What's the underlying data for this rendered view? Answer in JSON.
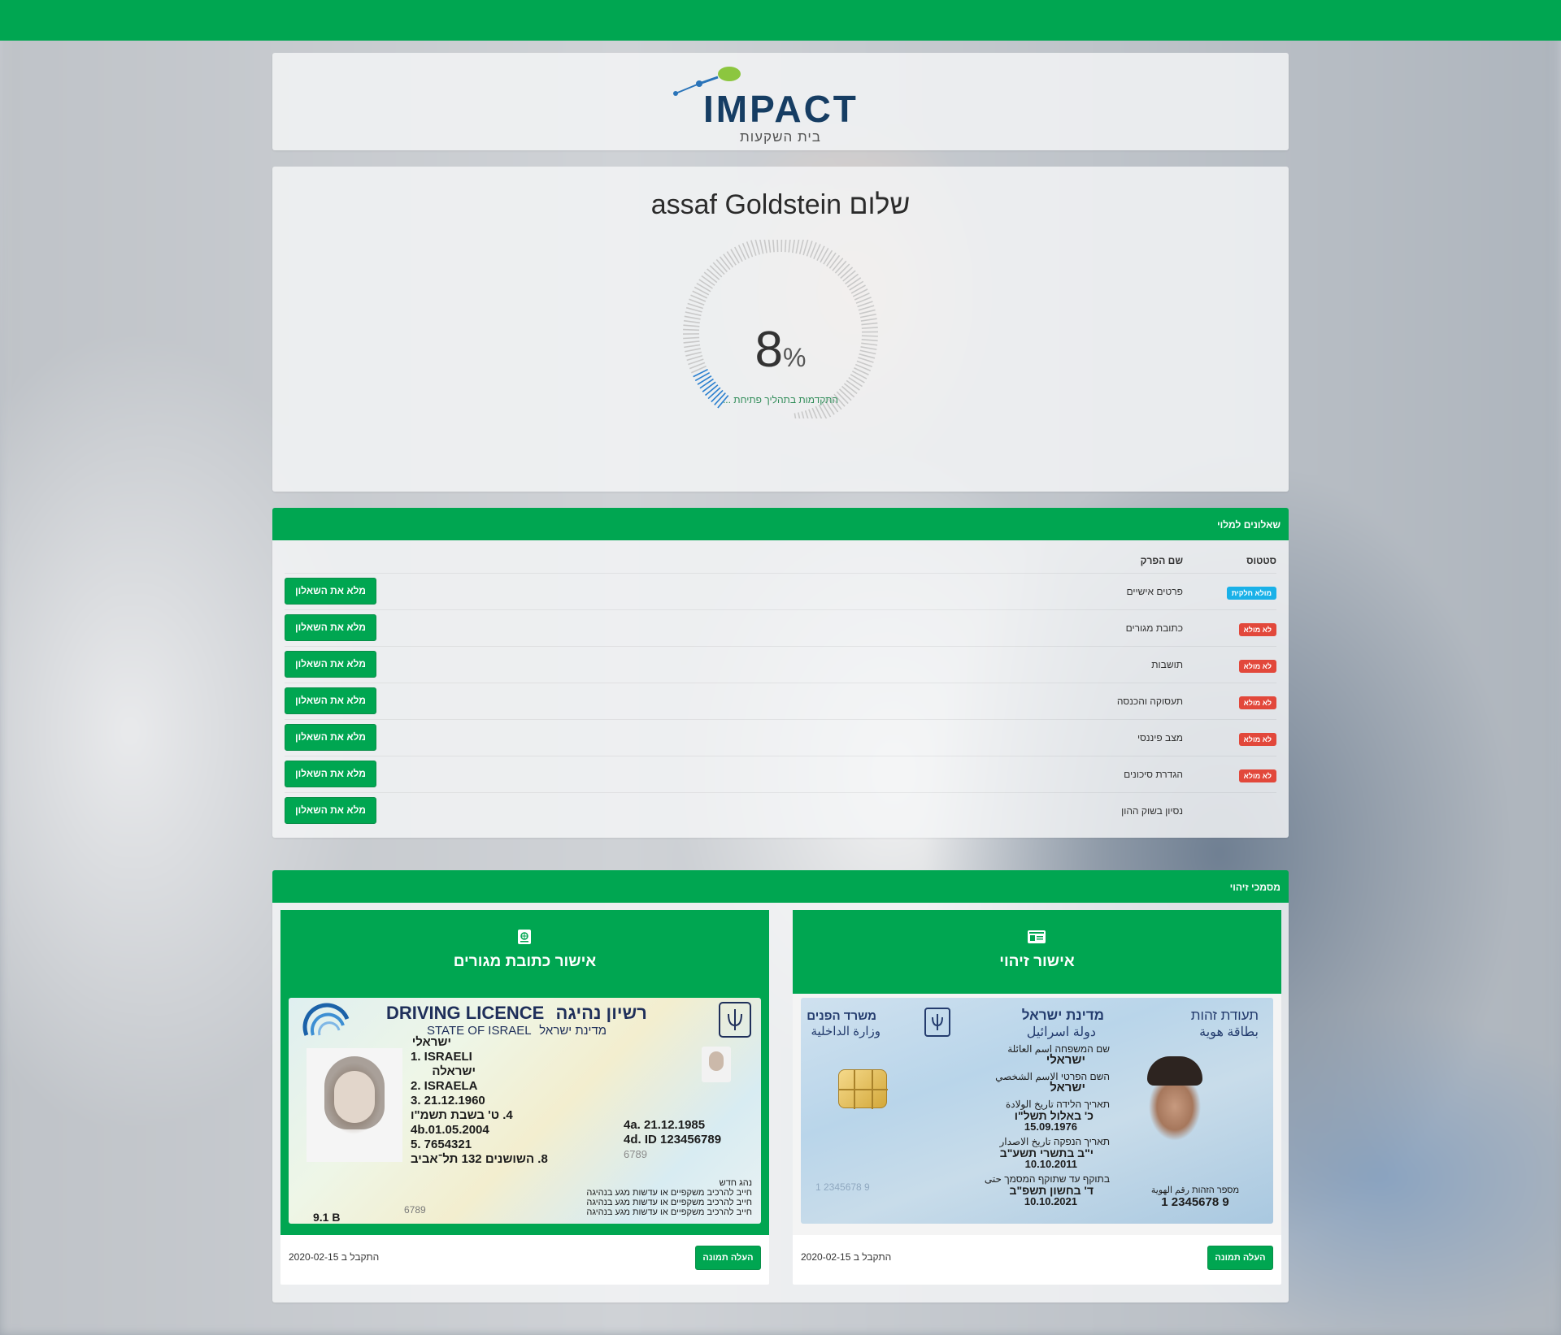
{
  "brand": {
    "logo_text": "IMPACT",
    "logo_subtitle": "בית השקעות",
    "color_primary": "#00a651"
  },
  "greeting": {
    "text": "שלום assaf Goldstein"
  },
  "progress": {
    "value": "8",
    "unit": "%",
    "percent": 8,
    "label": "התקדמות בתהליך פתיחת ..."
  },
  "questionnaires": {
    "title": "שאלונים למלוי",
    "col_status": "סטטוס",
    "col_name": "שם הפרק",
    "rows": [
      {
        "status": "מולא חלקית",
        "status_color": "blue",
        "name": "פרטים אישיים",
        "action": "מלא את השאלון"
      },
      {
        "status": "לא מולא",
        "status_color": "red",
        "name": "כתובת מגורים",
        "action": "מלא את השאלון"
      },
      {
        "status": "לא מולא",
        "status_color": "red",
        "name": "תושבות",
        "action": "מלא את השאלון"
      },
      {
        "status": "לא מולא",
        "status_color": "red",
        "name": "תעסוקה והכנסה",
        "action": "מלא את השאלון"
      },
      {
        "status": "לא מולא",
        "status_color": "red",
        "name": "מצב פיננסי",
        "action": "מלא את השאלון"
      },
      {
        "status": "לא מולא",
        "status_color": "red",
        "name": "הגדרת סיכונים",
        "action": "מלא את השאלון"
      },
      {
        "status": "",
        "status_color": "",
        "name": "נסיון בשוק ההון",
        "action": "מלא את השאלון"
      }
    ]
  },
  "documents": {
    "title": "מסמכי זיהוי",
    "cards": [
      {
        "title": "אישור כתובת מגורים",
        "icon": "address-book-icon",
        "received": "התקבל ב 2020-02-15",
        "upload": "העלה תמונה",
        "card": {
          "title_en": "DRIVING LICENCE",
          "title_he": "רשיון נהיגה",
          "state_en": "STATE OF ISRAEL",
          "state_he": "מדינת ישראל",
          "l1": "ישראלי",
          "f1": "1. ISRAELI",
          "l2": "ישראלה",
          "f2": "2. ISRAELA",
          "f3": "3. 21.12.1960",
          "f4": "4. ט' בשבת תשמ\"ו",
          "f4a": "4a. 21.12.1985",
          "f4b": "4b.01.05.2004",
          "f4d": "4d. ID 123456789",
          "f5": "5. 7654321",
          "f5b": "6789",
          "f8": "8. השושנים 132 תל־אביב",
          "n1": "נהג חדש",
          "n2": "חייב להרכיב משקפיים או עדשות מגע בנהיגה",
          "n3": "חייב להרכיב משקפיים או עדשות מגע בנהיגה",
          "n4": "חייב להרכיב משקפיים או עדשות מגע בנהיגה",
          "code": "6789",
          "cls": "9.1 B"
        }
      },
      {
        "title": "אישור זיהוי",
        "icon": "id-card-icon",
        "received": "התקבל ב 2020-02-15",
        "upload": "העלה תמונה",
        "card": {
          "t1": "תעודת זהות",
          "t1b": "بطاقة هوية",
          "t2": "מדינת ישראל",
          "t2b": "دولة اسرائيل",
          "t3": "משרד הפנים",
          "t3b": "وزارة الداخلية",
          "f_family_label": "שם המשפחה اسم العائلة",
          "f_family": "ישראלי",
          "f_given_label": "השם הפרטי الاسم الشخصي",
          "f_given": "ישראל",
          "f_dob_label": "תאריך הלידה تاريخ الولادة",
          "f_dob": "כ' באלול תשל\"ו",
          "f_dob2": "15.09.1976",
          "f_issue_label": "תאריך הנפקה تاريخ الاصدار",
          "f_issue": "י\"ב בתשרי תשע\"ב",
          "f_issue2": "10.10.2011",
          "f_exp_label": "בתוקף עד שתוקף המסמך حتى",
          "f_exp": "ד' בחשון תשפ\"ב",
          "f_exp2": "10.10.2021",
          "id_label": "מספר הזהות رقم الهوية",
          "id_num": "1 2345678 9",
          "id_small": "1 2345678 9"
        }
      }
    ]
  }
}
